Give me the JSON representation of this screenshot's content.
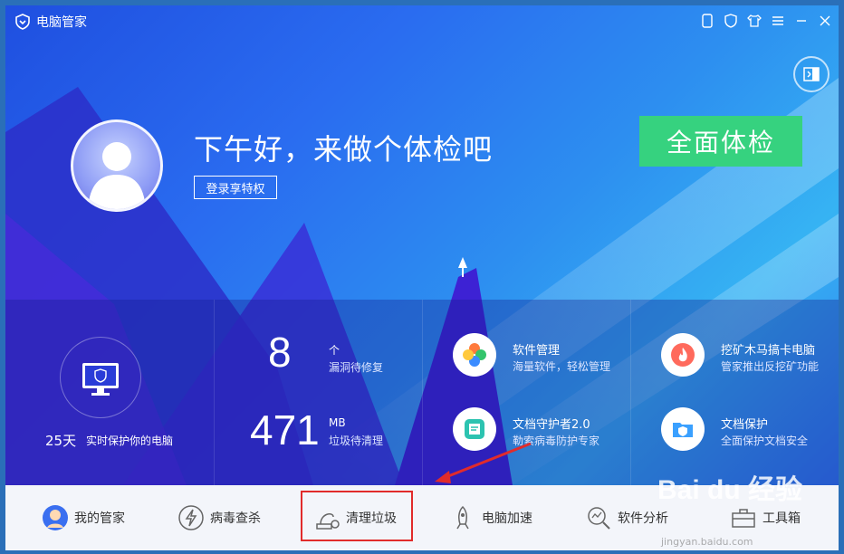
{
  "app": {
    "title": "电脑管家"
  },
  "header": {
    "greeting": "下午好，来做个体检吧",
    "login_button": "登录享特权",
    "scan_button": "全面体检"
  },
  "protection": {
    "days": "25天",
    "label": "实时保护你的电脑"
  },
  "stats": [
    {
      "value": "8",
      "unit": "个",
      "label": "漏洞待修复"
    },
    {
      "value": "471",
      "unit": "MB",
      "label": "垃圾待清理"
    }
  ],
  "features": [
    {
      "title": "软件管理",
      "subtitle": "海量软件，轻松管理"
    },
    {
      "title": "挖矿木马搞卡电脑",
      "subtitle": "管家推出反挖矿功能"
    },
    {
      "title": "文档守护者2.0",
      "subtitle": "勒索病毒防护专家"
    },
    {
      "title": "文档保护",
      "subtitle": "全面保护文档安全"
    }
  ],
  "nav": [
    {
      "label": "我的管家"
    },
    {
      "label": "病毒查杀"
    },
    {
      "label": "清理垃圾"
    },
    {
      "label": "电脑加速"
    },
    {
      "label": "软件分析"
    },
    {
      "label": "工具箱"
    }
  ],
  "watermark": {
    "logo": "Bai du 经验",
    "url": "jingyan.baidu.com"
  },
  "colors": {
    "accent_green": "#36d27f",
    "highlight_red": "#e12b2b"
  }
}
